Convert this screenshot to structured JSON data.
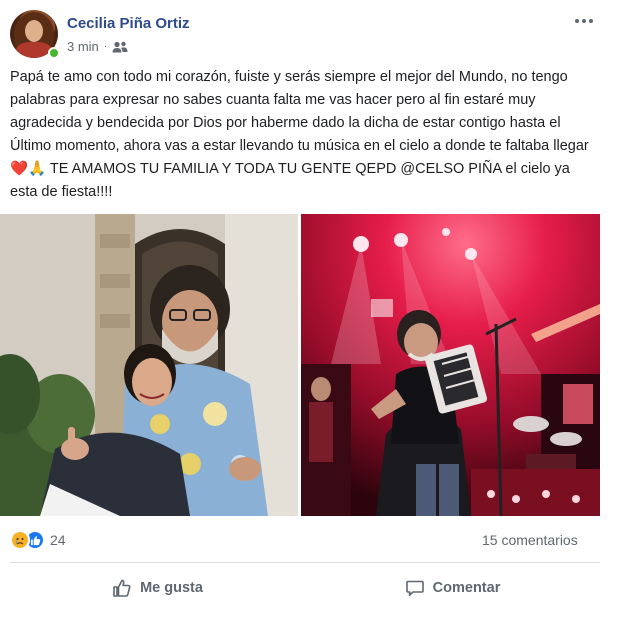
{
  "post": {
    "author": "Cecilia Piña Ortiz",
    "time": "3 min",
    "audience_icon": "friends-icon",
    "text": "Papá te amo con todo mi corazón, fuiste y serás siempre el mejor del Mundo, no tengo palabras para expresar no sabes cuanta falta me vas hacer pero al fin estaré muy agradecida y bendecida por Dios por haberme dado la dicha de estar contigo hasta el Último momento, ahora vas a estar llevando tu música en el cielo a donde te faltaba llegar",
    "text_emojis": [
      "❤️",
      "🙏"
    ],
    "text_tail": " TE AMAMOS TU FAMILIA Y TODA TU GENTE QEPD @CELSO PIÑA el cielo ya esta de fiesta!!!!"
  },
  "photos": [
    {
      "icon": "photo-family-portrait"
    },
    {
      "icon": "photo-concert-stage"
    }
  ],
  "stats": {
    "reactions": [
      "sad",
      "like"
    ],
    "reaction_count": "24",
    "comments": "15 comentarios"
  },
  "actions": {
    "like_label": "Me gusta",
    "comment_label": "Comentar"
  },
  "colors": {
    "author": "#2d4b8c",
    "secondary_text": "#606770",
    "online": "#42b72a",
    "like_blue": "#1877f2",
    "sad_yellow": "#f7b125"
  }
}
